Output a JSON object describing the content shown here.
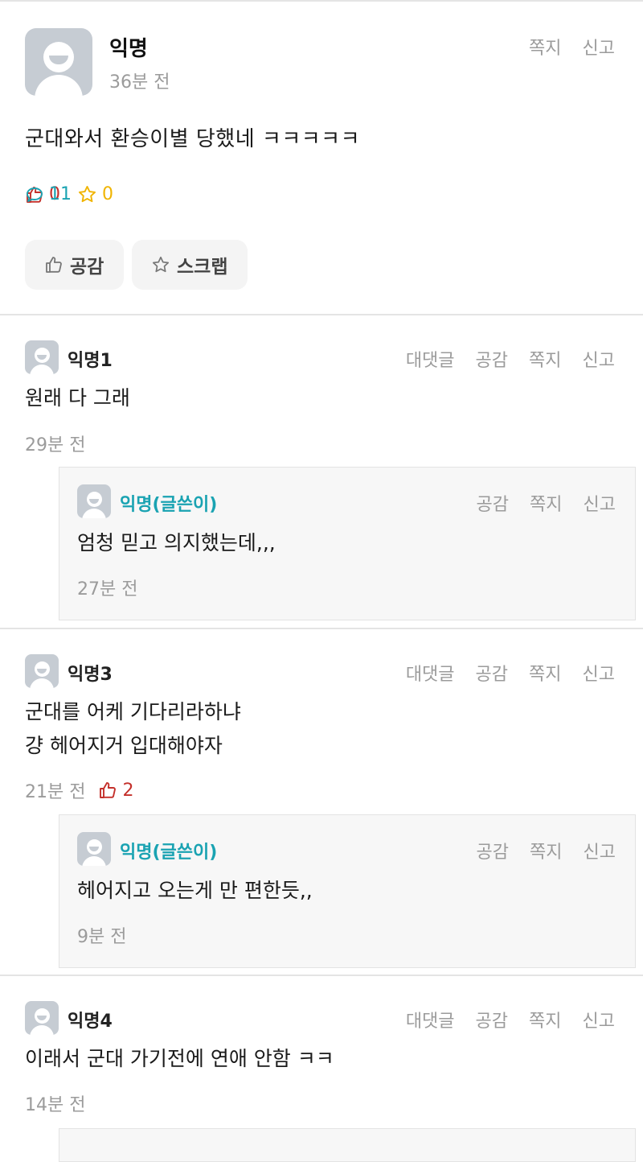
{
  "post": {
    "author": "익명",
    "time": "36분 전",
    "actions": [
      "쪽지",
      "신고"
    ],
    "body": "군대와서 환승이별 당했네 ㅋㅋㅋㅋㅋ",
    "stats": {
      "likes": "0",
      "comments": "11",
      "scraps": "0"
    },
    "buttons": {
      "like": "공감",
      "scrap": "스크랩"
    }
  },
  "comments": [
    {
      "author": "익명1",
      "actions": [
        "대댓글",
        "공감",
        "쪽지",
        "신고"
      ],
      "text": "원래 다 그래",
      "time": "29분 전",
      "reply": {
        "author": "익명(글쓴이)",
        "actions": [
          "공감",
          "쪽지",
          "신고"
        ],
        "text": "엄청 믿고 의지했는데,,,",
        "time": "27분 전"
      }
    },
    {
      "author": "익명3",
      "actions": [
        "대댓글",
        "공감",
        "쪽지",
        "신고"
      ],
      "text_lines": [
        "군대를 어케 기다리라하냐",
        "걍 헤어지거 입대해야자"
      ],
      "time": "21분 전",
      "likes": "2",
      "reply": {
        "author": "익명(글쓴이)",
        "actions": [
          "공감",
          "쪽지",
          "신고"
        ],
        "text": "헤어지고 오는게 만 편한듯,,",
        "time": "9분 전"
      }
    },
    {
      "author": "익명4",
      "actions": [
        "대댓글",
        "공감",
        "쪽지",
        "신고"
      ],
      "text": "이래서 군대 가기전에 연애 안함 ㅋㅋ",
      "time": "14분 전"
    }
  ],
  "colors": {
    "like": "#c4302b",
    "comment": "#1aa3b2",
    "scrap": "#f0b400",
    "op": "#1aa3b2",
    "muted": "#9b9b9b"
  },
  "icons": [
    "thumbs-up-icon",
    "speech-bubble-icon",
    "star-icon",
    "avatar-icon"
  ]
}
